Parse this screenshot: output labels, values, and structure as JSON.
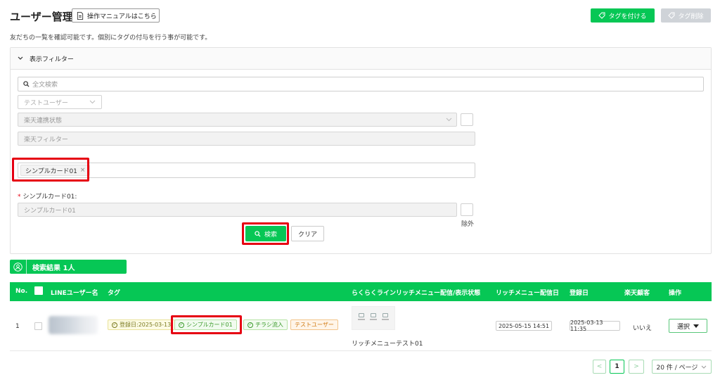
{
  "header": {
    "title": "ユーザー管理",
    "manual_button": "操作マニュアルはこちら",
    "add_tag_button": "タグを付ける",
    "remove_tag_button": "タグ削除",
    "subtitle": "友だちの一覧を確認可能です。個別にタグの付与を行う事が可能です。"
  },
  "filter": {
    "title": "表示フィルター",
    "search_placeholder": "全文検索",
    "test_user_select": "テストユーザー",
    "rakuten_status_select": "楽天連携状態",
    "rakuten_filter_placeholder": "楽天フィルター",
    "selected_tag": "シンプルカード01",
    "selected_tag_remove": "×",
    "card_field_required_mark": "*",
    "card_field_label": "シンプルカード01:",
    "card_field_placeholder": "シンプルカード01",
    "exclude_label": "除外",
    "search_button": "検索",
    "clear_button": "クリア"
  },
  "results": {
    "label": "検索結果",
    "count": "1人"
  },
  "table": {
    "columns": {
      "no": "No.",
      "line_user": "LINEユーザー名",
      "tag": "タグ",
      "rich_menu": "らくらくラインリッチメニュー配信/表示状態",
      "rich_menu_date": "リッチメニュー配信日",
      "registered": "登録日",
      "rakuten": "楽天顧客",
      "action": "操作"
    },
    "rows": [
      {
        "no": "1",
        "tags": [
          "登録日:2025-03-13",
          "シンプルカード01",
          "チラシ流入",
          "テストユーザー"
        ],
        "rich_menu_name": "リッチメニューテスト01",
        "rich_menu_date": "2025-05-15 14:51",
        "registered": "2025-03-13 11:35",
        "rakuten": "いいえ",
        "action": "選択"
      }
    ]
  },
  "pagination": {
    "prev": "<",
    "current": "1",
    "next": ">",
    "page_size": "20 件 / ページ"
  },
  "colors": {
    "brand_green": "#06c755",
    "highlight_red": "#e60012"
  }
}
